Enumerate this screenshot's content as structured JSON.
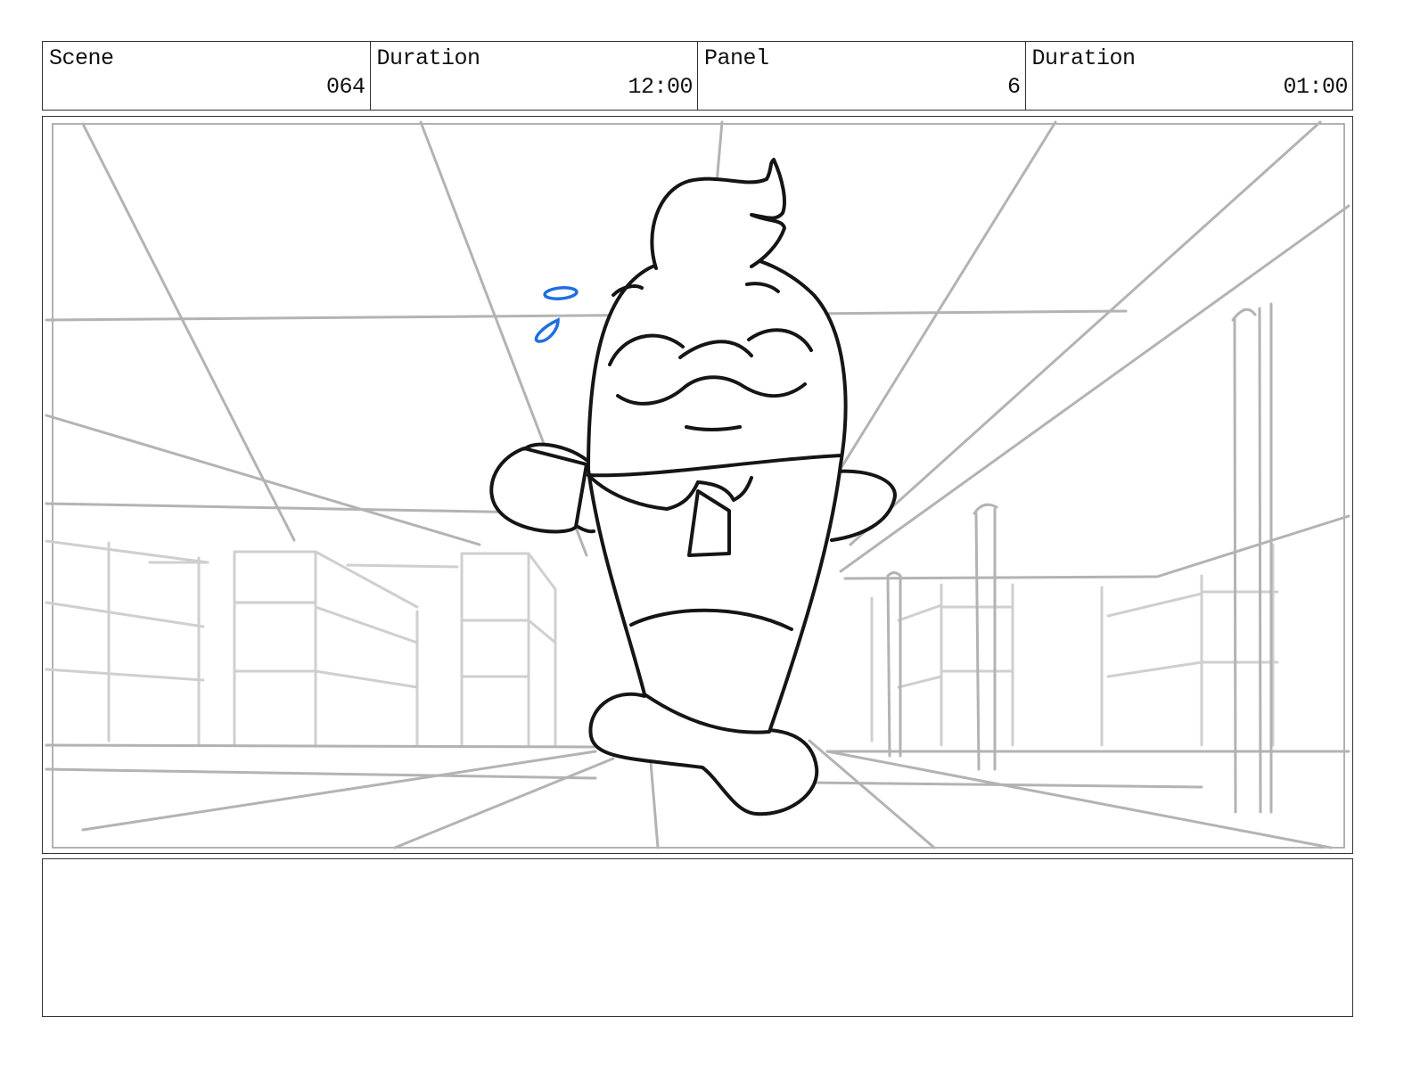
{
  "header": {
    "scene_label": "Scene",
    "scene_value": "064",
    "scene_duration_label": "Duration",
    "scene_duration_value": "12:00",
    "panel_label": "Panel",
    "panel_value": "6",
    "panel_duration_label": "Duration",
    "panel_duration_value": "01:00"
  },
  "notes": {
    "text": ""
  },
  "colors": {
    "ink": "#151515",
    "perspective_guides": "#b3b3b3",
    "sweat_drops": "#1e6fe0"
  },
  "icons": {
    "character": "fish-mascot-character",
    "sweat": "sweat-drops-icon"
  }
}
